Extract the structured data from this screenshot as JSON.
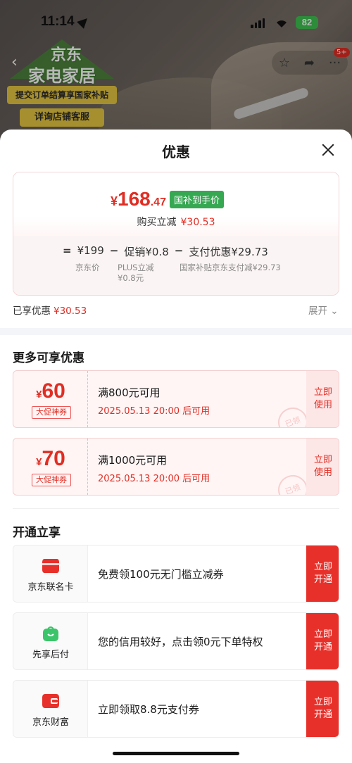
{
  "status_bar": {
    "time": "11:14",
    "battery": "82"
  },
  "background": {
    "logo_line1": "京东",
    "logo_line2": "家电家居",
    "banner1": "提交订单结算享国家补贴",
    "banner2": "详询店铺客服",
    "nav_badge": "5+"
  },
  "sheet": {
    "title": "优惠",
    "price": {
      "currency": "¥",
      "integer": "168",
      "decimal": ".47",
      "tag": "国补到手价",
      "buy_label": "购买立减",
      "buy_amount": "¥30.53"
    },
    "formula": {
      "eq": "=",
      "base": "¥199",
      "minus1": "−",
      "promo": "促销¥0.8",
      "minus2": "−",
      "pay": "支付优惠¥29.73",
      "base_label": "京东价",
      "promo_label_1": "PLUS立减",
      "promo_label_2": "¥0.8元",
      "pay_label": "国家补贴京东支付减¥29.73"
    },
    "enjoyed_label": "已享优惠",
    "enjoyed_amount": "¥30.53",
    "expand_label": "展开 ⌄",
    "more_title": "更多可享优惠",
    "coupons": [
      {
        "currency": "¥",
        "amount": "60",
        "tag": "大促神券",
        "condition": "满800元可用",
        "time": "2025.05.13 20:00 后可用",
        "action": "立即使用",
        "stamp": "已领"
      },
      {
        "currency": "¥",
        "amount": "70",
        "tag": "大促神券",
        "condition": "满1000元可用",
        "time": "2025.05.13 20:00 后可用",
        "action": "立即使用",
        "stamp": "已领"
      }
    ],
    "open_title": "开通立享",
    "members": [
      {
        "name": "京东联名卡",
        "desc": "免费领100元无门槛立减券",
        "action": "立即开通",
        "color": "#e8302a"
      },
      {
        "name": "先享后付",
        "desc": "您的信用较好，点击领0元下单特权",
        "action": "立即开通",
        "color": "#3cc46a"
      },
      {
        "name": "京东财富",
        "desc": "立即领取8.8元支付券",
        "action": "立即开通",
        "color": "#e8302a"
      }
    ]
  },
  "colors": {
    "accent": "#e02e24",
    "green_tag": "#36a852",
    "button_red": "#e8302a"
  }
}
